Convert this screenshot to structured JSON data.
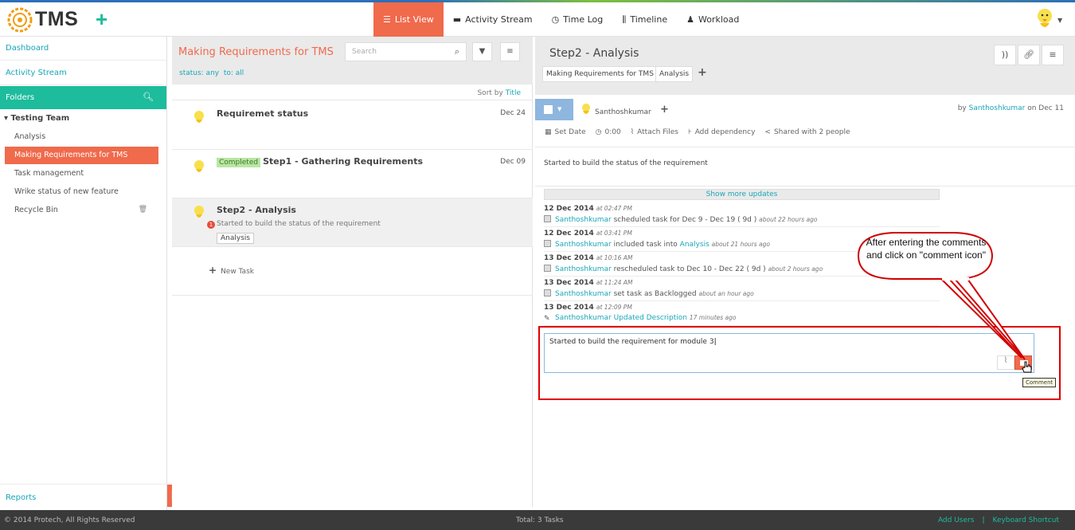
{
  "app": {
    "logo_text": "TMS",
    "add_symbol": "+"
  },
  "nav": {
    "items": [
      {
        "icon": "list-icon",
        "label": "List View",
        "active": true
      },
      {
        "icon": "comment-icon",
        "label": "Activity Stream"
      },
      {
        "icon": "clock-icon",
        "label": "Time Log"
      },
      {
        "icon": "timeline-icon",
        "label": "Timeline"
      },
      {
        "icon": "user-icon",
        "label": "Workload"
      }
    ]
  },
  "sidebar": {
    "dashboard": "Dashboard",
    "activity": "Activity Stream",
    "folders": "Folders",
    "team": "Testing Team",
    "items": [
      {
        "label": "Analysis"
      },
      {
        "label": "Making Requirements for TMS",
        "active": true
      },
      {
        "label": "Task management"
      },
      {
        "label": "Wrike status of new feature"
      },
      {
        "label": "Recycle Bin"
      }
    ],
    "reports": "Reports"
  },
  "tasklist": {
    "title": "Making Requirements for TMS",
    "search_placeholder": "Search",
    "filter_status": "status: any",
    "filter_to": "to: all",
    "sort_prefix": "Sort by",
    "sort_field": "Title",
    "tasks": [
      {
        "title": "Requiremet status",
        "date": "Dec 24"
      },
      {
        "badge": "Completed",
        "title": "Step1 - Gathering Requirements",
        "date": "Dec 09"
      },
      {
        "title": "Step2 - Analysis",
        "subtitle": "Started to build the status of the requirement",
        "tag": "Analysis",
        "notif": "1"
      }
    ],
    "new_task": "New Task"
  },
  "detail": {
    "title": "Step2 - Analysis",
    "tags": [
      "Making Requirements for TMS",
      "Analysis"
    ],
    "assignee": "Santhoshkumar",
    "by_prefix": "by",
    "by_user": "Santhoshkumar",
    "by_suffix": "on Dec 11",
    "tools": [
      "Set Date",
      "0:00",
      "Attach Files",
      "Add dependency",
      "Shared with 2 people"
    ],
    "description": "Started to build the status of the requirement",
    "show_more": "Show more updates",
    "updates": [
      {
        "date": "12 Dec 2014",
        "time": "at 02:47 PM",
        "user": "Santhoshkumar",
        "text": "scheduled task for Dec 9 - Dec 19 ( 9d )",
        "ago": "about 22 hours ago"
      },
      {
        "date": "12 Dec 2014",
        "time": "at 03:41 PM",
        "user": "Santhoshkumar",
        "text": "included task into",
        "link": "Analysis",
        "ago": "about 21 hours ago"
      },
      {
        "date": "13 Dec 2014",
        "time": "at 10:16 AM",
        "user": "Santhoshkumar",
        "text": "rescheduled task to Dec 10 - Dec 22 ( 9d )",
        "ago": "about 2 hours ago"
      },
      {
        "date": "13 Dec 2014",
        "time": "at 11:24 AM",
        "user": "Santhoshkumar",
        "text": "set task as Backlogged",
        "ago": "about an hour ago"
      },
      {
        "date": "13 Dec 2014",
        "time": "at 12:09 PM",
        "user": "Santhoshkumar",
        "link": "Updated Description",
        "ago": "17 minutes ago"
      }
    ],
    "comment_value": "Started to build the requirement for module 3",
    "comment_tooltip": "Comment"
  },
  "callout": {
    "text": "After entering the comments and click on \"comment icon\""
  },
  "footer": {
    "copyright": "© 2014 Protech, All Rights Reserved",
    "total": "Total: 3 Tasks",
    "add_users": "Add Users",
    "separator": "|",
    "shortcut": "Keyboard Shortcut"
  },
  "colors": {
    "accent": "#f06a4c",
    "teal": "#1dbc9c",
    "link": "#1aa6b7"
  }
}
